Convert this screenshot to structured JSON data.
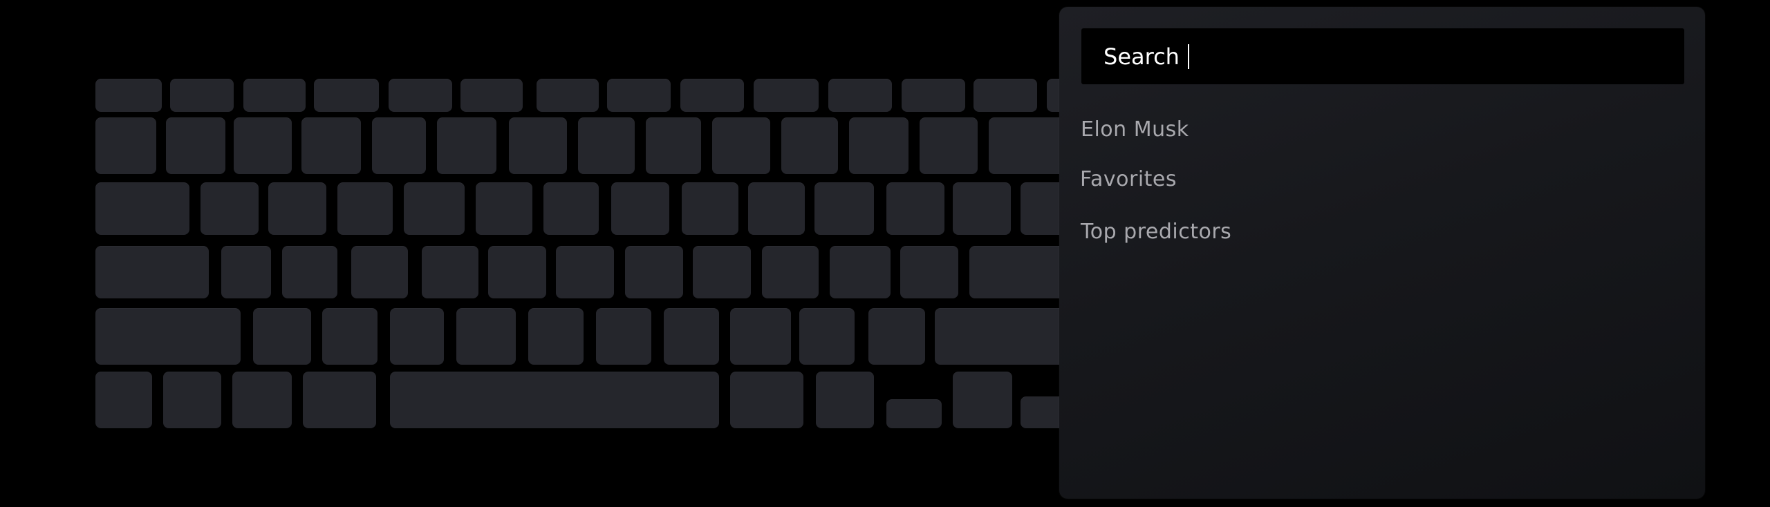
{
  "search": {
    "label": "Search"
  },
  "suggestions": [
    {
      "label": "Elon  Musk"
    },
    {
      "label": "Favorites"
    },
    {
      "label": "Top predictors"
    }
  ],
  "colors": {
    "background": "#000000",
    "key": "#25262c",
    "panel": "#1a1b20",
    "search_box": "#000000",
    "search_text": "#ffffff",
    "suggestion_text": "#a9a9ae"
  }
}
